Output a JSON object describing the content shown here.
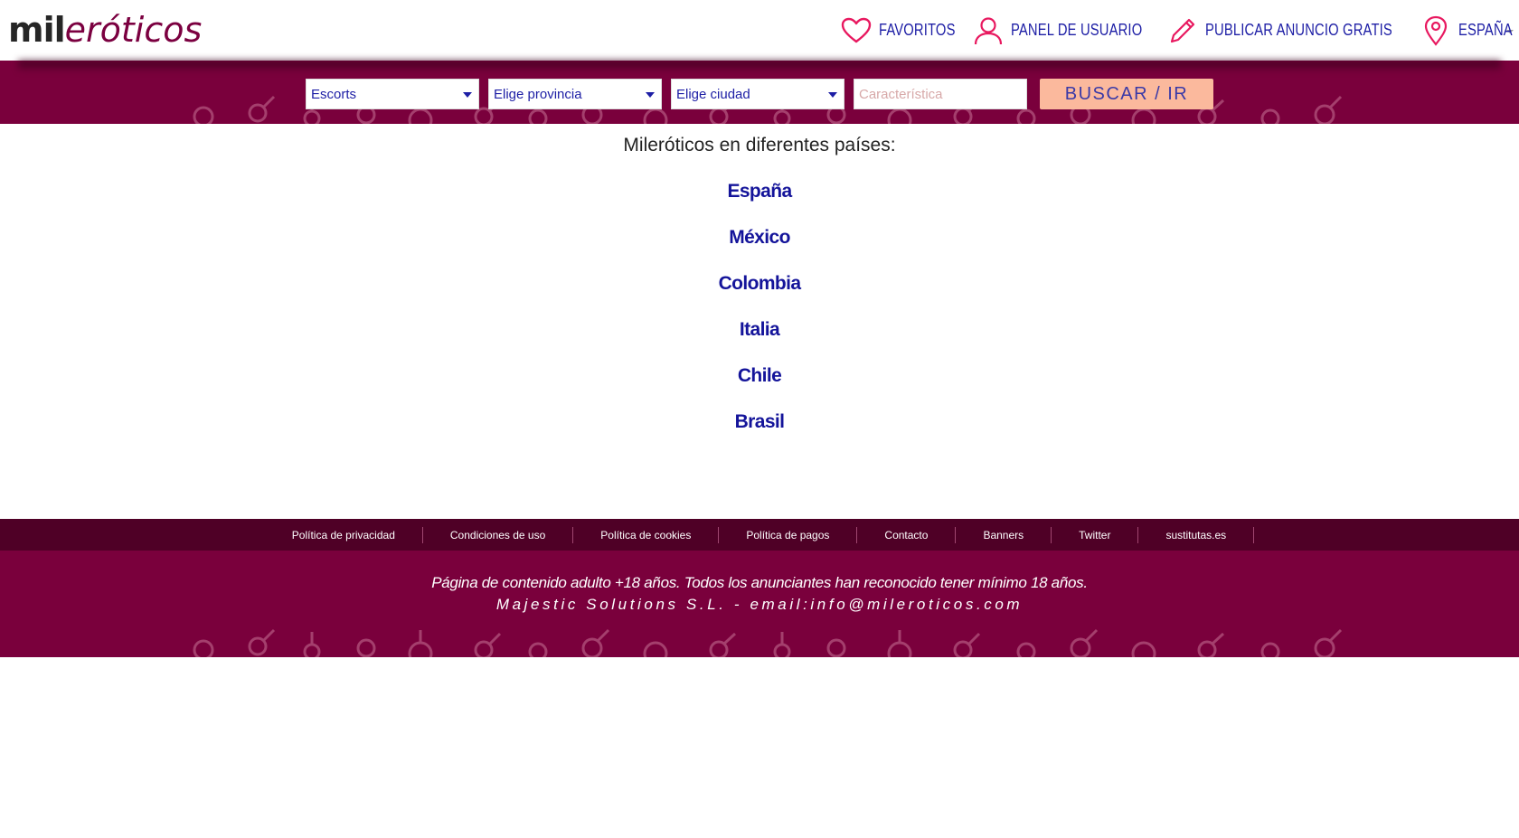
{
  "header": {
    "logo_part1": "mil",
    "logo_part2": "eróticos",
    "nav": [
      {
        "label": "FAVORITOS",
        "icon": "heart-icon"
      },
      {
        "label": "PANEL DE USUARIO",
        "icon": "user-icon"
      },
      {
        "label": "PUBLICAR ANUNCIO GRATIS",
        "icon": "pencil-icon"
      },
      {
        "label": "ESPAÑA",
        "icon": "location-pin-icon"
      }
    ]
  },
  "search": {
    "category": "Escorts",
    "province": "Elige provincia",
    "city": "Elige ciudad",
    "feature_placeholder": "Característica",
    "button": "BUSCAR / IR"
  },
  "main": {
    "intro": "Mileróticos en diferentes países:",
    "countries": [
      "España",
      "México",
      "Colombia",
      "Italia",
      "Chile",
      "Brasil"
    ]
  },
  "footer": {
    "links": [
      "Política de privacidad",
      "Condiciones de uso",
      "Política de cookies",
      "Política de pagos",
      "Contacto",
      "Banners",
      "Twitter",
      "sustitutas.es"
    ],
    "notice": "Página de contenido adulto +18 años. Todos los anunciantes han reconocido tener mínimo 18 años.",
    "company": "Majestic Solutions S.L. - email:info@mileroticos.com"
  },
  "colors": {
    "accent": "#7a003c",
    "link": "#14149a",
    "button": "#fbb99d",
    "icon": "#e8185f"
  }
}
